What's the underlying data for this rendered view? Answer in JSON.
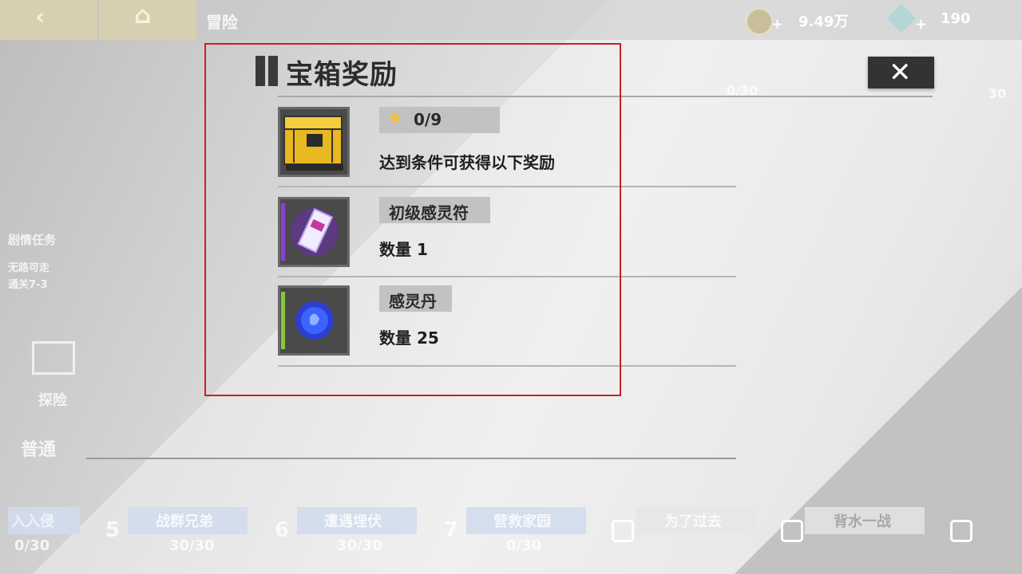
{
  "topbar": {
    "back_icon": "‹",
    "home_icon": "⌂",
    "breadcrumb": "冒险",
    "gold_value": "9.49万",
    "gem_value": "190",
    "plus": "+"
  },
  "background": {
    "plot_title": "剧情任务",
    "plot_sub1": "无路可走",
    "plot_sub2": "通关7-3",
    "adventure_label": "探险",
    "mode_label": "普通",
    "top_right_count": "0/30",
    "top_right_count2": "30",
    "levels": [
      {
        "label": "入入侵",
        "progress": "0/30"
      },
      {
        "num": "5",
        "label": "战群兄弟",
        "progress": "30/30"
      },
      {
        "num": "6",
        "label": "遭遇埋伏",
        "progress": "30/30"
      },
      {
        "num": "7",
        "label": "营救家园",
        "progress": "0/30"
      },
      {
        "label": "为了过去"
      },
      {
        "label": "背水一战"
      }
    ]
  },
  "modal": {
    "title": "宝箱奖励",
    "close_icon": "✕",
    "requirement": {
      "stars": "0/9",
      "description": "达到条件可获得以下奖励"
    },
    "rewards": [
      {
        "name": "初级感灵符",
        "quantity": "数量 1",
        "accent": "#8a3fd8"
      },
      {
        "name": "感灵丹",
        "quantity": "数量 25",
        "accent": "#8ac53a"
      }
    ]
  },
  "colors": {
    "star": "#f2c230",
    "chest_gold": "#e8b820",
    "highlight": "#cc1f1f"
  }
}
